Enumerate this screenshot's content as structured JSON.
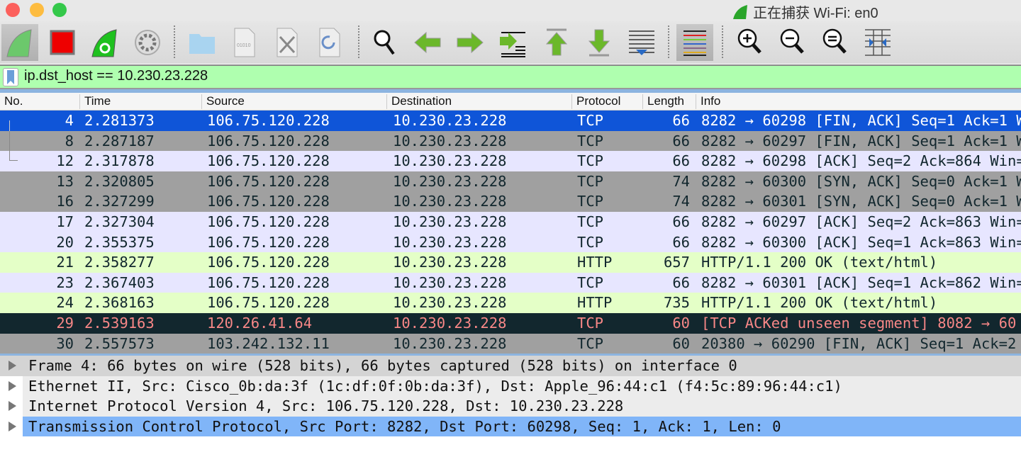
{
  "window": {
    "title": "正在捕获 Wi-Fi: en0"
  },
  "toolbar": {
    "buttons": [
      {
        "name": "start-capture-icon"
      },
      {
        "name": "stop-capture-icon"
      },
      {
        "name": "restart-capture-icon"
      },
      {
        "name": "capture-options-icon"
      },
      {
        "name": "open-file-icon"
      },
      {
        "name": "save-file-icon"
      },
      {
        "name": "close-file-icon"
      },
      {
        "name": "reload-file-icon"
      },
      {
        "name": "find-packet-icon"
      },
      {
        "name": "go-back-icon"
      },
      {
        "name": "go-forward-icon"
      },
      {
        "name": "go-to-packet-icon"
      },
      {
        "name": "first-packet-icon"
      },
      {
        "name": "last-packet-icon"
      },
      {
        "name": "autoscroll-icon"
      },
      {
        "name": "colorize-icon"
      },
      {
        "name": "zoom-in-icon"
      },
      {
        "name": "zoom-out-icon"
      },
      {
        "name": "normal-size-icon"
      },
      {
        "name": "resize-columns-icon"
      }
    ]
  },
  "filter": {
    "value": "ip.dst_host == 10.230.23.228",
    "bg_color": "#afffaf"
  },
  "columns": [
    "No.",
    "Time",
    "Source",
    "Destination",
    "Protocol",
    "Length",
    "Info"
  ],
  "packets": [
    {
      "no": "4",
      "time": "2.281373",
      "src": "106.75.120.228",
      "dst": "10.230.23.228",
      "proto": "TCP",
      "len": "66",
      "info": "8282 → 60298 [FIN, ACK] Seq=1 Ack=1 W",
      "style": "selected"
    },
    {
      "no": "8",
      "time": "2.287187",
      "src": "106.75.120.228",
      "dst": "10.230.23.228",
      "proto": "TCP",
      "len": "66",
      "info": "8282 → 60297 [FIN, ACK] Seq=1 Ack=1 W",
      "style": "gray"
    },
    {
      "no": "12",
      "time": "2.317878",
      "src": "106.75.120.228",
      "dst": "10.230.23.228",
      "proto": "TCP",
      "len": "66",
      "info": "8282 → 60298 [ACK] Seq=2 Ack=864 Win=",
      "style": "tcp"
    },
    {
      "no": "13",
      "time": "2.320805",
      "src": "106.75.120.228",
      "dst": "10.230.23.228",
      "proto": "TCP",
      "len": "74",
      "info": "8282 → 60300 [SYN, ACK] Seq=0 Ack=1 W",
      "style": "gray"
    },
    {
      "no": "16",
      "time": "2.327299",
      "src": "106.75.120.228",
      "dst": "10.230.23.228",
      "proto": "TCP",
      "len": "74",
      "info": "8282 → 60301 [SYN, ACK] Seq=0 Ack=1 W",
      "style": "gray"
    },
    {
      "no": "17",
      "time": "2.327304",
      "src": "106.75.120.228",
      "dst": "10.230.23.228",
      "proto": "TCP",
      "len": "66",
      "info": "8282 → 60297 [ACK] Seq=2 Ack=863 Win=",
      "style": "tcp"
    },
    {
      "no": "20",
      "time": "2.355375",
      "src": "106.75.120.228",
      "dst": "10.230.23.228",
      "proto": "TCP",
      "len": "66",
      "info": "8282 → 60300 [ACK] Seq=1 Ack=863 Win=",
      "style": "tcp"
    },
    {
      "no": "21",
      "time": "2.358277",
      "src": "106.75.120.228",
      "dst": "10.230.23.228",
      "proto": "HTTP",
      "len": "657",
      "info": "HTTP/1.1 200 OK  (text/html)",
      "style": "http"
    },
    {
      "no": "23",
      "time": "2.367403",
      "src": "106.75.120.228",
      "dst": "10.230.23.228",
      "proto": "TCP",
      "len": "66",
      "info": "8282 → 60301 [ACK] Seq=1 Ack=862 Win=",
      "style": "tcp"
    },
    {
      "no": "24",
      "time": "2.368163",
      "src": "106.75.120.228",
      "dst": "10.230.23.228",
      "proto": "HTTP",
      "len": "735",
      "info": "HTTP/1.1 200 OK  (text/html)",
      "style": "http"
    },
    {
      "no": "29",
      "time": "2.539163",
      "src": "120.26.41.64",
      "dst": "10.230.23.228",
      "proto": "TCP",
      "len": "60",
      "info": "[TCP ACKed unseen segment] 8082 → 60",
      "style": "bad"
    },
    {
      "no": "30",
      "time": "2.557573",
      "src": "103.242.132.11",
      "dst": "10.230.23.228",
      "proto": "TCP",
      "len": "60",
      "info": "20380 → 60290 [FIN, ACK] Seq=1 Ack=2",
      "style": "gray"
    }
  ],
  "row_colors": {
    "selected": {
      "bg": "#0f55d8",
      "fg": "#ffffff"
    },
    "gray": {
      "bg": "#a0a0a0",
      "fg": "#12272e"
    },
    "tcp": {
      "bg": "#e7e6ff",
      "fg": "#12272e"
    },
    "http": {
      "bg": "#e4ffc7",
      "fg": "#12272e"
    },
    "bad": {
      "bg": "#12272e",
      "fg": "#f78787"
    }
  },
  "details": [
    {
      "text": "Frame 4: 66 bytes on wire (528 bits), 66 bytes captured (528 bits) on interface 0",
      "style": "first"
    },
    {
      "text": "Ethernet II, Src: Cisco_0b:da:3f (1c:df:0f:0b:da:3f), Dst: Apple_96:44:c1 (f4:5c:89:96:44:c1)",
      "style": "alt"
    },
    {
      "text": "Internet Protocol Version 4, Src: 106.75.120.228, Dst: 10.230.23.228",
      "style": "alt"
    },
    {
      "text": "Transmission Control Protocol, Src Port: 8282, Dst Port: 60298, Seq: 1, Ack: 1, Len: 0",
      "style": "selected"
    }
  ]
}
